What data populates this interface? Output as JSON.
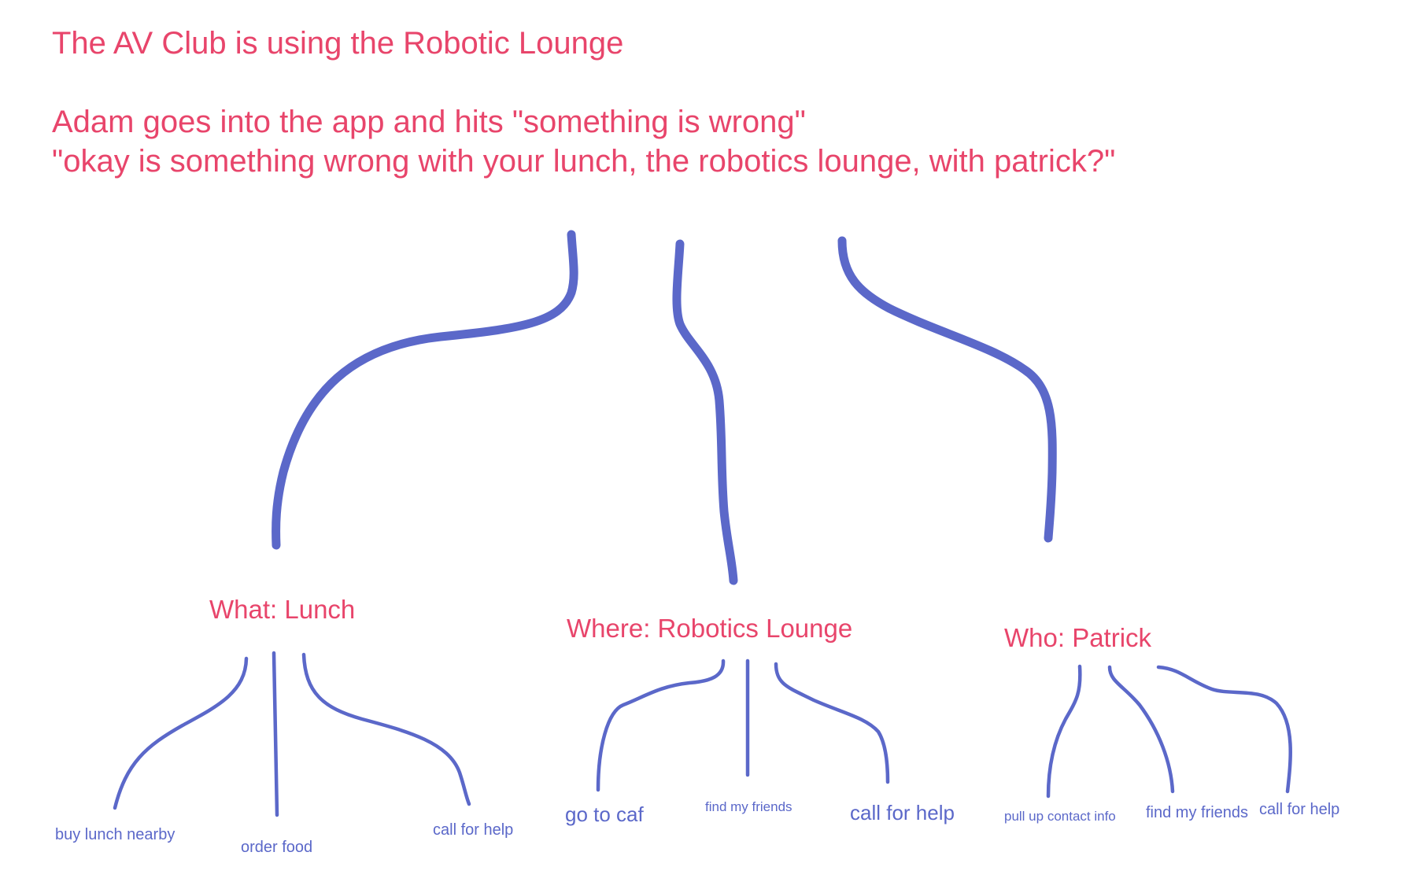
{
  "intro": {
    "line1": "The AV Club is using the Robotic Lounge",
    "line2": "Adam goes into the app and hits \"something is wrong\"",
    "line3": "\"okay is something wrong with your lunch, the robotics lounge, with patrick?\""
  },
  "branches": [
    {
      "label": "What: Lunch",
      "options": [
        "buy lunch nearby",
        "order food",
        "call for help"
      ]
    },
    {
      "label": "Where: Robotics Lounge",
      "options": [
        "go to caf",
        "find my friends",
        "call for help"
      ]
    },
    {
      "label": "Who: Patrick",
      "options": [
        "pull up contact info",
        "find my friends",
        "call for help"
      ]
    }
  ],
  "colors": {
    "text_accent": "#e8456b",
    "stroke": "#5b68c9",
    "background": "#ffffff"
  }
}
